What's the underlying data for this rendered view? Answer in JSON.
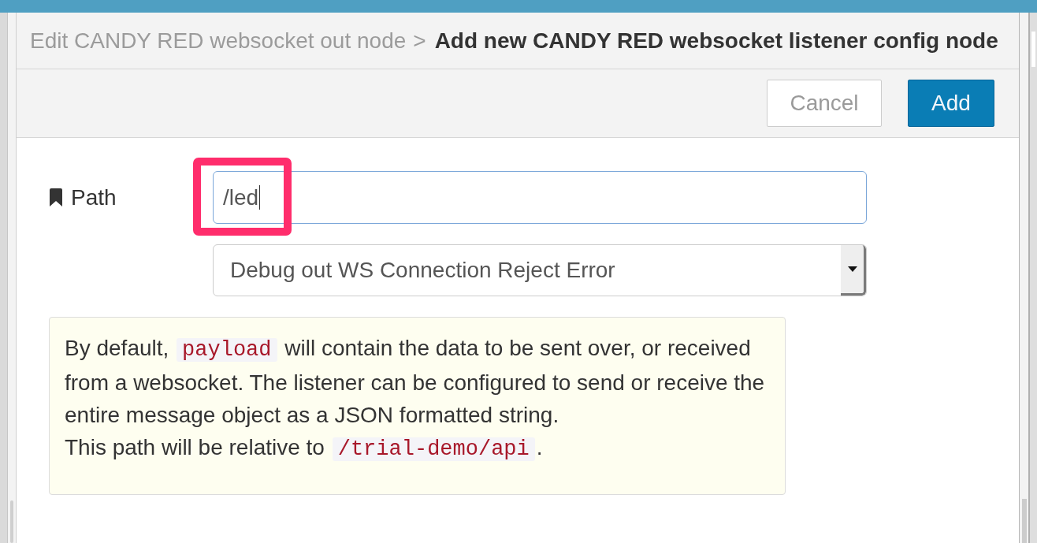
{
  "header": {
    "breadcrumb": "Edit CANDY RED websocket out node",
    "separator": ">",
    "title": "Add new CANDY RED websocket listener config node"
  },
  "buttons": [
    {
      "label": "Cancel",
      "kind": "secondary"
    },
    {
      "label": "Add",
      "kind": "primary"
    }
  ],
  "fields": [
    {
      "kind": "text",
      "label": "Path",
      "value": "/led",
      "focused": true,
      "highlighted": true
    },
    {
      "kind": "select",
      "value": "Debug out WS Connection Reject Error"
    }
  ],
  "help": {
    "paragraphs": [
      [
        {
          "kind": "text",
          "text": "By default, "
        },
        {
          "kind": "code",
          "text": "payload"
        },
        {
          "kind": "text",
          "text": " will contain the data to be sent over, or received from a websocket. The listener can be configured to send or receive the entire message object as a JSON formatted string."
        }
      ],
      [
        {
          "kind": "text",
          "text": "This path will be relative to "
        },
        {
          "kind": "code",
          "text": "/trial-demo/api"
        },
        {
          "kind": "text",
          "text": "."
        }
      ]
    ]
  }
}
